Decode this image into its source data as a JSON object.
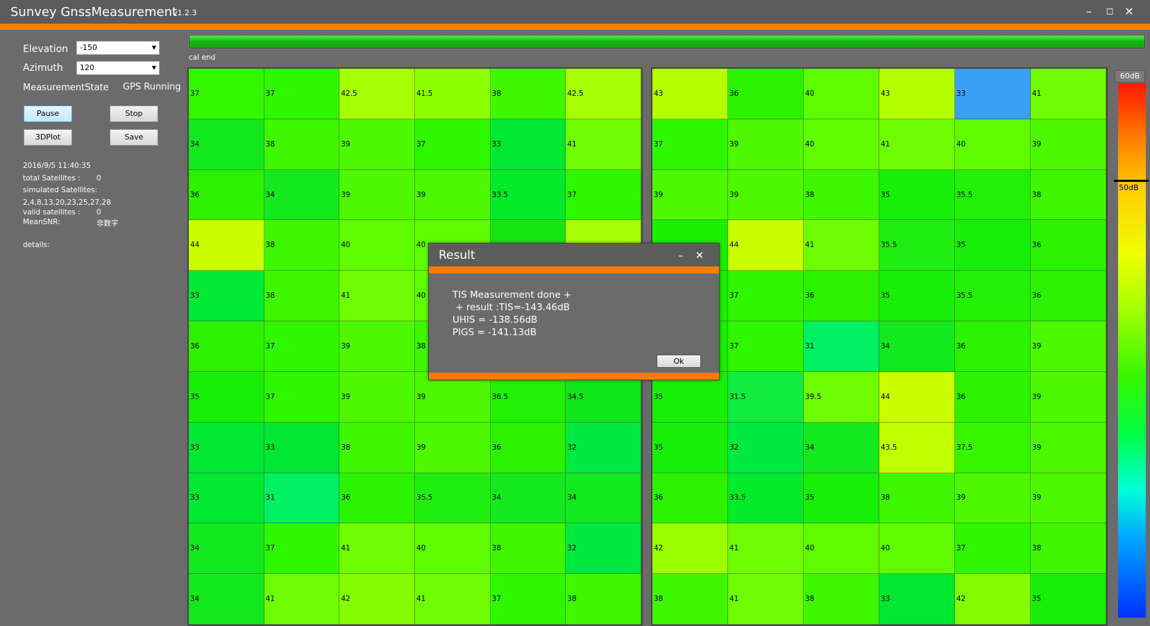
{
  "window": {
    "title": "Sunvey GnssMeasurement",
    "version": "v1.2.3",
    "minimize": "–",
    "maximize": "◻",
    "close": "✕"
  },
  "controls": {
    "elevation_label": "Elevation",
    "elevation_value": "-150",
    "azimuth_label": "Azimuth",
    "azimuth_value": "120",
    "state_label": "MeasurementState",
    "state_value": "GPS Running",
    "pause": "Pause",
    "stop": "Stop",
    "plot3d": "3DPlot",
    "save": "Save"
  },
  "info": {
    "datetime": "2016/9/5 11:40:35",
    "total_label": "total Satellites :",
    "total_value": "0",
    "simulated_label": "simulated Satellites:",
    "simulated_value": "2,4,8,13,20,23,25,27,28",
    "valid_label": "valid satellites :",
    "valid_value": "0",
    "meansnr_label": "MeanSNR:",
    "meansnr_value": "非数字",
    "details_label": "details:"
  },
  "progress": {
    "fraction": 1.0,
    "status": "cal end"
  },
  "colorscale": {
    "top_label": "60dB",
    "mid_label": "50dB"
  },
  "grid_left": [
    [
      "37",
      "37",
      "42.5",
      "41.5",
      "38",
      "42.5"
    ],
    [
      "34",
      "38",
      "39",
      "37",
      "33",
      "41"
    ],
    [
      "36",
      "34",
      "39",
      "39",
      "33.5",
      "37"
    ],
    [
      "44",
      "38",
      "40",
      "40",
      "",
      ""
    ],
    [
      "33",
      "38",
      "41",
      "40",
      "",
      ""
    ],
    [
      "36",
      "37",
      "39",
      "38",
      "",
      ""
    ],
    [
      "35",
      "37",
      "39",
      "39",
      "36.5",
      "34.5"
    ],
    [
      "33",
      "33",
      "38",
      "39",
      "36",
      "32"
    ],
    [
      "33",
      "31",
      "36",
      "35.5",
      "34",
      "34"
    ],
    [
      "34",
      "37",
      "41",
      "40",
      "38",
      "32"
    ],
    [
      "34",
      "41",
      "42",
      "41",
      "37",
      "38"
    ]
  ],
  "grid_left_colors": [
    [
      "#33f700",
      "#2ef700",
      "#a6ff00",
      "#8cff00",
      "#3ef700",
      "#a6ff00"
    ],
    [
      "#14e81e",
      "#3ef700",
      "#4ef900",
      "#2ef700",
      "#00e832",
      "#6ffc00"
    ],
    [
      "#2cf200",
      "#14e81e",
      "#4ef900",
      "#4ef900",
      "#05ea2a",
      "#2ef700"
    ],
    [
      "#caff00",
      "#3ef700",
      "#5ffb00",
      "#5ffb00",
      "#16e412",
      "#a6ff00"
    ],
    [
      "#00ea36",
      "#3ef700",
      "#6ffc00",
      "#5ffb00",
      "#4ef900",
      "#4ef900"
    ],
    [
      "#2cf200",
      "#2ef700",
      "#4ef900",
      "#3ef700",
      "#4ef900",
      "#4ef900"
    ],
    [
      "#18ef08",
      "#2ef700",
      "#4ef900",
      "#4ef900",
      "#22f004",
      "#10e61a"
    ],
    [
      "#00e832",
      "#00e832",
      "#3ef700",
      "#4ef900",
      "#2cf200",
      "#00ea40"
    ],
    [
      "#00e832",
      "#00f064",
      "#2cf200",
      "#20ee10",
      "#14e81e",
      "#14e81e"
    ],
    [
      "#14e81e",
      "#2ef700",
      "#6ffc00",
      "#5ffb00",
      "#3ef700",
      "#00ea40"
    ],
    [
      "#14e81e",
      "#6ffc00",
      "#84fd00",
      "#6ffc00",
      "#2ef700",
      "#3ef700"
    ]
  ],
  "grid_right": [
    [
      "43",
      "36",
      "40",
      "43",
      "33",
      "41"
    ],
    [
      "37",
      "39",
      "40",
      "41",
      "40",
      "39"
    ],
    [
      "39",
      "39",
      "38",
      "35",
      "35.5",
      "38"
    ],
    [
      "",
      "44",
      "41",
      "35.5",
      "35",
      "36"
    ],
    [
      "",
      "37",
      "36",
      "35",
      "35.5",
      "36"
    ],
    [
      "",
      "37",
      "31",
      "34",
      "36",
      "39"
    ],
    [
      "35",
      "31.5",
      "39.5",
      "44",
      "36",
      "39"
    ],
    [
      "35",
      "32",
      "34",
      "43.5",
      "37.5",
      "39"
    ],
    [
      "36",
      "33.5",
      "35",
      "38",
      "39",
      "39"
    ],
    [
      "42",
      "41",
      "40",
      "40",
      "37",
      "38"
    ],
    [
      "38",
      "41",
      "38",
      "33",
      "42",
      "35"
    ]
  ],
  "grid_right_colors": [
    [
      "#b4ff00",
      "#2cf200",
      "#5ffb00",
      "#b4ff00",
      "#39a0f5",
      "#6ffc00"
    ],
    [
      "#2ef700",
      "#4ef900",
      "#5ffb00",
      "#6ffc00",
      "#5ffb00",
      "#4ef900"
    ],
    [
      "#4ef900",
      "#4ef900",
      "#3ef700",
      "#18ef08",
      "#22f004",
      "#3ef700"
    ],
    [
      "#1af000",
      "#caff00",
      "#6ffc00",
      "#20ee10",
      "#18ef08",
      "#2cf200"
    ],
    [
      "#1af000",
      "#2ef700",
      "#2cf200",
      "#18ef08",
      "#22f004",
      "#2cf200"
    ],
    [
      "#1af000",
      "#2ef700",
      "#00f064",
      "#14e81e",
      "#2cf200",
      "#4ef900"
    ],
    [
      "#18ef08",
      "#10ec40",
      "#6ffc00",
      "#caff00",
      "#2cf200",
      "#4ef900"
    ],
    [
      "#18ef08",
      "#00ea40",
      "#14e81e",
      "#c0ff00",
      "#35f500",
      "#4ef900"
    ],
    [
      "#2cf200",
      "#05ea2a",
      "#18ef08",
      "#3ef700",
      "#4ef900",
      "#4ef900"
    ],
    [
      "#9cff00",
      "#6ffc00",
      "#5ffb00",
      "#5ffb00",
      "#2ef700",
      "#3ef700"
    ],
    [
      "#3ef700",
      "#6ffc00",
      "#3ef700",
      "#00e832",
      "#84fd00",
      "#18ef08"
    ]
  ],
  "dialog": {
    "title": "Result",
    "minimize": "–",
    "close": "✕",
    "line1": "TIS Measurement done +",
    "line2": " + result :TIS=-143.46dB",
    "line3": "UHIS = -138.56dB",
    "line4": "PIGS = -141.13dB",
    "ok": "Ok"
  }
}
